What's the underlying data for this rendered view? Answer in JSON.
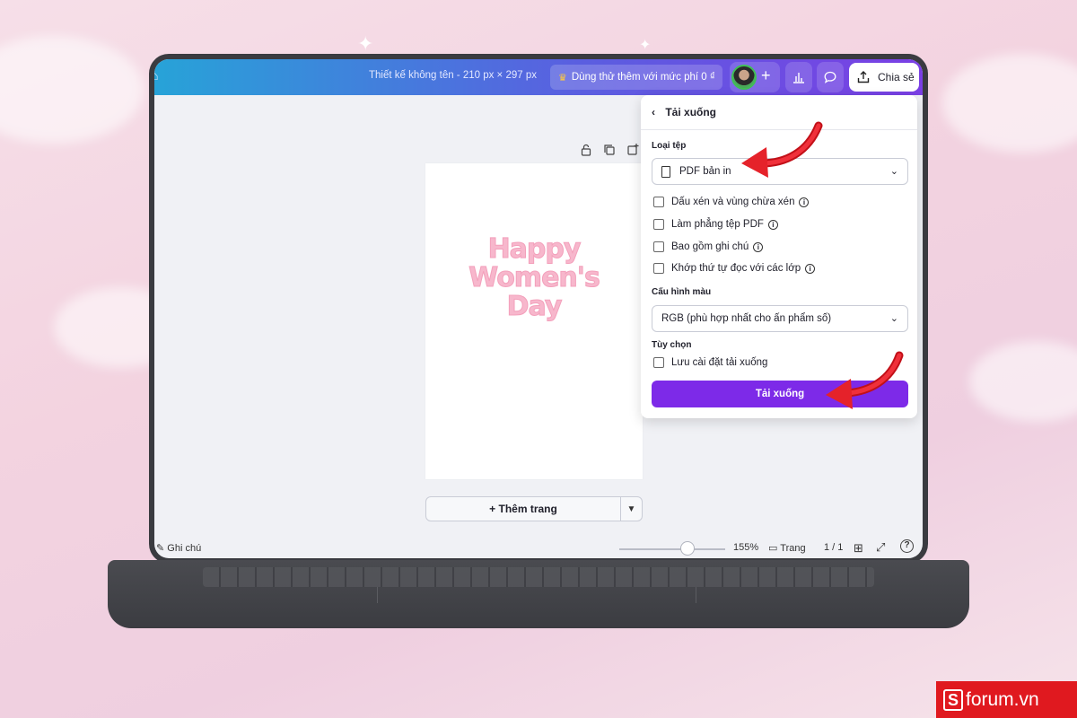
{
  "topbar": {
    "doc_title": "Thiết kế không tên - 210 px × 297 px",
    "trial_label": "Dùng thử thêm với mức phí 0 ₫",
    "share_label": "Chia sẻ"
  },
  "canvas": {
    "design_text": [
      "Happy",
      "Women's",
      "Day"
    ],
    "add_page_label": "+ Thêm trang"
  },
  "bottombar": {
    "notes_label": "Ghi chú",
    "zoom_label": "155%",
    "zoom_level": 0.64,
    "pages_label": "Trang",
    "page_count": "1 / 1"
  },
  "download_panel": {
    "title": "Tải xuống",
    "file_type_label": "Loại tệp",
    "file_type_value": "PDF bản in",
    "options": [
      {
        "label": "Dấu xén và vùng chừa xén",
        "checked": false,
        "info": true
      },
      {
        "label": "Làm phẳng tệp PDF",
        "checked": false,
        "info": true
      },
      {
        "label": "Bao gồm ghi chú",
        "checked": false,
        "info": true
      },
      {
        "label": "Khớp thứ tự đọc với các lớp",
        "checked": false,
        "info": true
      }
    ],
    "color_profile_label": "Cấu hình màu",
    "color_profile_value": "RGB (phù hợp nhất cho ấn phẩm số)",
    "extra_label": "Tùy chọn",
    "save_settings_label": "Lưu cài đặt tải xuống",
    "download_button": "Tải xuống"
  },
  "colors": {
    "accent": "#7d2ae8",
    "topbar_start": "#27a3d8",
    "topbar_end": "#7a3fe4",
    "design_pink": "#f7b7cc",
    "annotation_red": "#e0191f"
  },
  "watermark": {
    "text": "forum.vn"
  }
}
